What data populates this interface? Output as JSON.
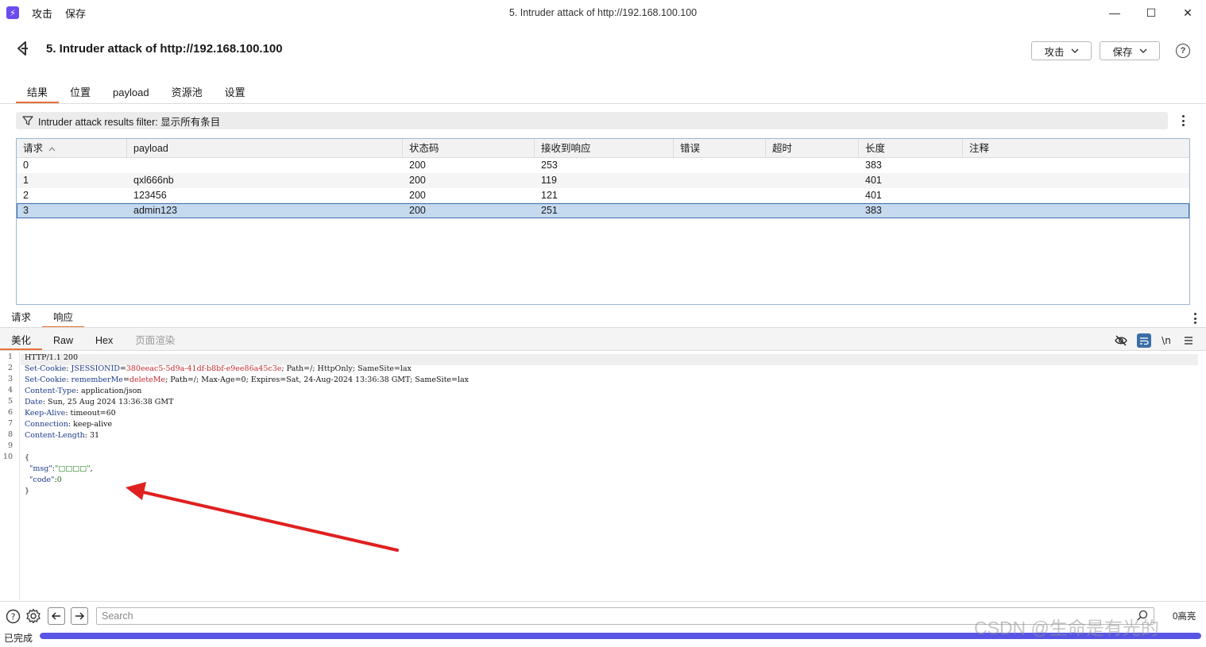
{
  "titlebar": {
    "menus": [
      "攻击",
      "保存"
    ],
    "title": "5. Intruder attack of http://192.168.100.100",
    "minimize": "—",
    "maximize": "☐",
    "close": "✕"
  },
  "header": {
    "title": "5. Intruder attack of http://192.168.100.100",
    "attack_btn": "攻击",
    "save_btn": "保存",
    "help": "?"
  },
  "tabs": [
    "结果",
    "位置",
    "payload",
    "资源池",
    "设置"
  ],
  "active_tab": "结果",
  "filter": {
    "text": "Intruder attack results filter: 显示所有条目"
  },
  "table": {
    "columns": [
      "请求",
      "payload",
      "状态码",
      "接收到响应",
      "错误",
      "超时",
      "长度",
      "注释"
    ],
    "sort_indicator": "^",
    "rows": [
      {
        "req": "0",
        "payload": "",
        "status": "200",
        "received": "253",
        "error": "",
        "timeout": "",
        "length": "383",
        "comment": ""
      },
      {
        "req": "1",
        "payload": "qxl666nb",
        "status": "200",
        "received": "119",
        "error": "",
        "timeout": "",
        "length": "401",
        "comment": ""
      },
      {
        "req": "2",
        "payload": "123456",
        "status": "200",
        "received": "121",
        "error": "",
        "timeout": "",
        "length": "401",
        "comment": ""
      },
      {
        "req": "3",
        "payload": "admin123",
        "status": "200",
        "received": "251",
        "error": "",
        "timeout": "",
        "length": "383",
        "comment": ""
      }
    ],
    "selected_row": "3"
  },
  "panel_tabs": [
    "请求",
    "响应"
  ],
  "active_panel_tab": "响应",
  "view_tabs": [
    "美化",
    "Raw",
    "Hex",
    "页面渲染"
  ],
  "active_view_tab": "美化",
  "editor": {
    "line_numbers": [
      "1",
      "2",
      "3",
      "4",
      "5",
      "6",
      "7",
      "8",
      "9",
      "10"
    ],
    "lines": [
      [
        {
          "t": "HTTP/1.1 200",
          "c": ""
        }
      ],
      [
        {
          "t": "Set-Cookie",
          "c": "k"
        },
        {
          "t": ": ",
          "c": ""
        },
        {
          "t": "JSESSIONID",
          "c": "k"
        },
        {
          "t": "=",
          "c": ""
        },
        {
          "t": "380eeac5-5d9a-41df-b8bf-e9ee86a45c3e",
          "c": "v"
        },
        {
          "t": "; Path=/; HttpOnly; SameSite=lax",
          "c": ""
        }
      ],
      [
        {
          "t": "Set-Cookie",
          "c": "k"
        },
        {
          "t": ": ",
          "c": ""
        },
        {
          "t": "rememberMe",
          "c": "k"
        },
        {
          "t": "=",
          "c": ""
        },
        {
          "t": "deleteMe",
          "c": "v"
        },
        {
          "t": "; Path=/; Max-Age=0; Expires=Sat, 24-Aug-2024 13:36:38 GMT; SameSite=lax",
          "c": ""
        }
      ],
      [
        {
          "t": "Content-Type",
          "c": "k"
        },
        {
          "t": ": application/json",
          "c": ""
        }
      ],
      [
        {
          "t": "Date",
          "c": "k"
        },
        {
          "t": ": Sun, 25 Aug 2024 13:36:38 GMT",
          "c": ""
        }
      ],
      [
        {
          "t": "Keep-Alive",
          "c": "k"
        },
        {
          "t": ": timeout=60",
          "c": ""
        }
      ],
      [
        {
          "t": "Connection",
          "c": "k"
        },
        {
          "t": ": keep-alive",
          "c": ""
        }
      ],
      [
        {
          "t": "Content-Length",
          "c": "k"
        },
        {
          "t": ": 31",
          "c": ""
        }
      ],
      [
        {
          "t": "",
          "c": ""
        }
      ],
      [
        {
          "t": "{",
          "c": ""
        }
      ],
      [
        {
          "t": "  ",
          "c": ""
        },
        {
          "t": "\"msg\"",
          "c": "k"
        },
        {
          "t": ":",
          "c": ""
        },
        {
          "t": "\"□□□□\"",
          "c": "s"
        },
        {
          "t": ",",
          "c": ""
        }
      ],
      [
        {
          "t": "  ",
          "c": ""
        },
        {
          "t": "\"code\"",
          "c": "k"
        },
        {
          "t": ":",
          "c": ""
        },
        {
          "t": "0",
          "c": "s"
        }
      ],
      [
        {
          "t": "}",
          "c": ""
        }
      ]
    ]
  },
  "search": {
    "placeholder": "Search",
    "match_count": "0高亮"
  },
  "status": {
    "text": "已完成",
    "progress": 1.0
  },
  "watermark": "CSDN @生命是有光的",
  "colors": {
    "accent": "#e8703a",
    "progress": "#5855e6",
    "selected_row": "#c5d9ef",
    "annotation_arrow": "#e02020"
  }
}
